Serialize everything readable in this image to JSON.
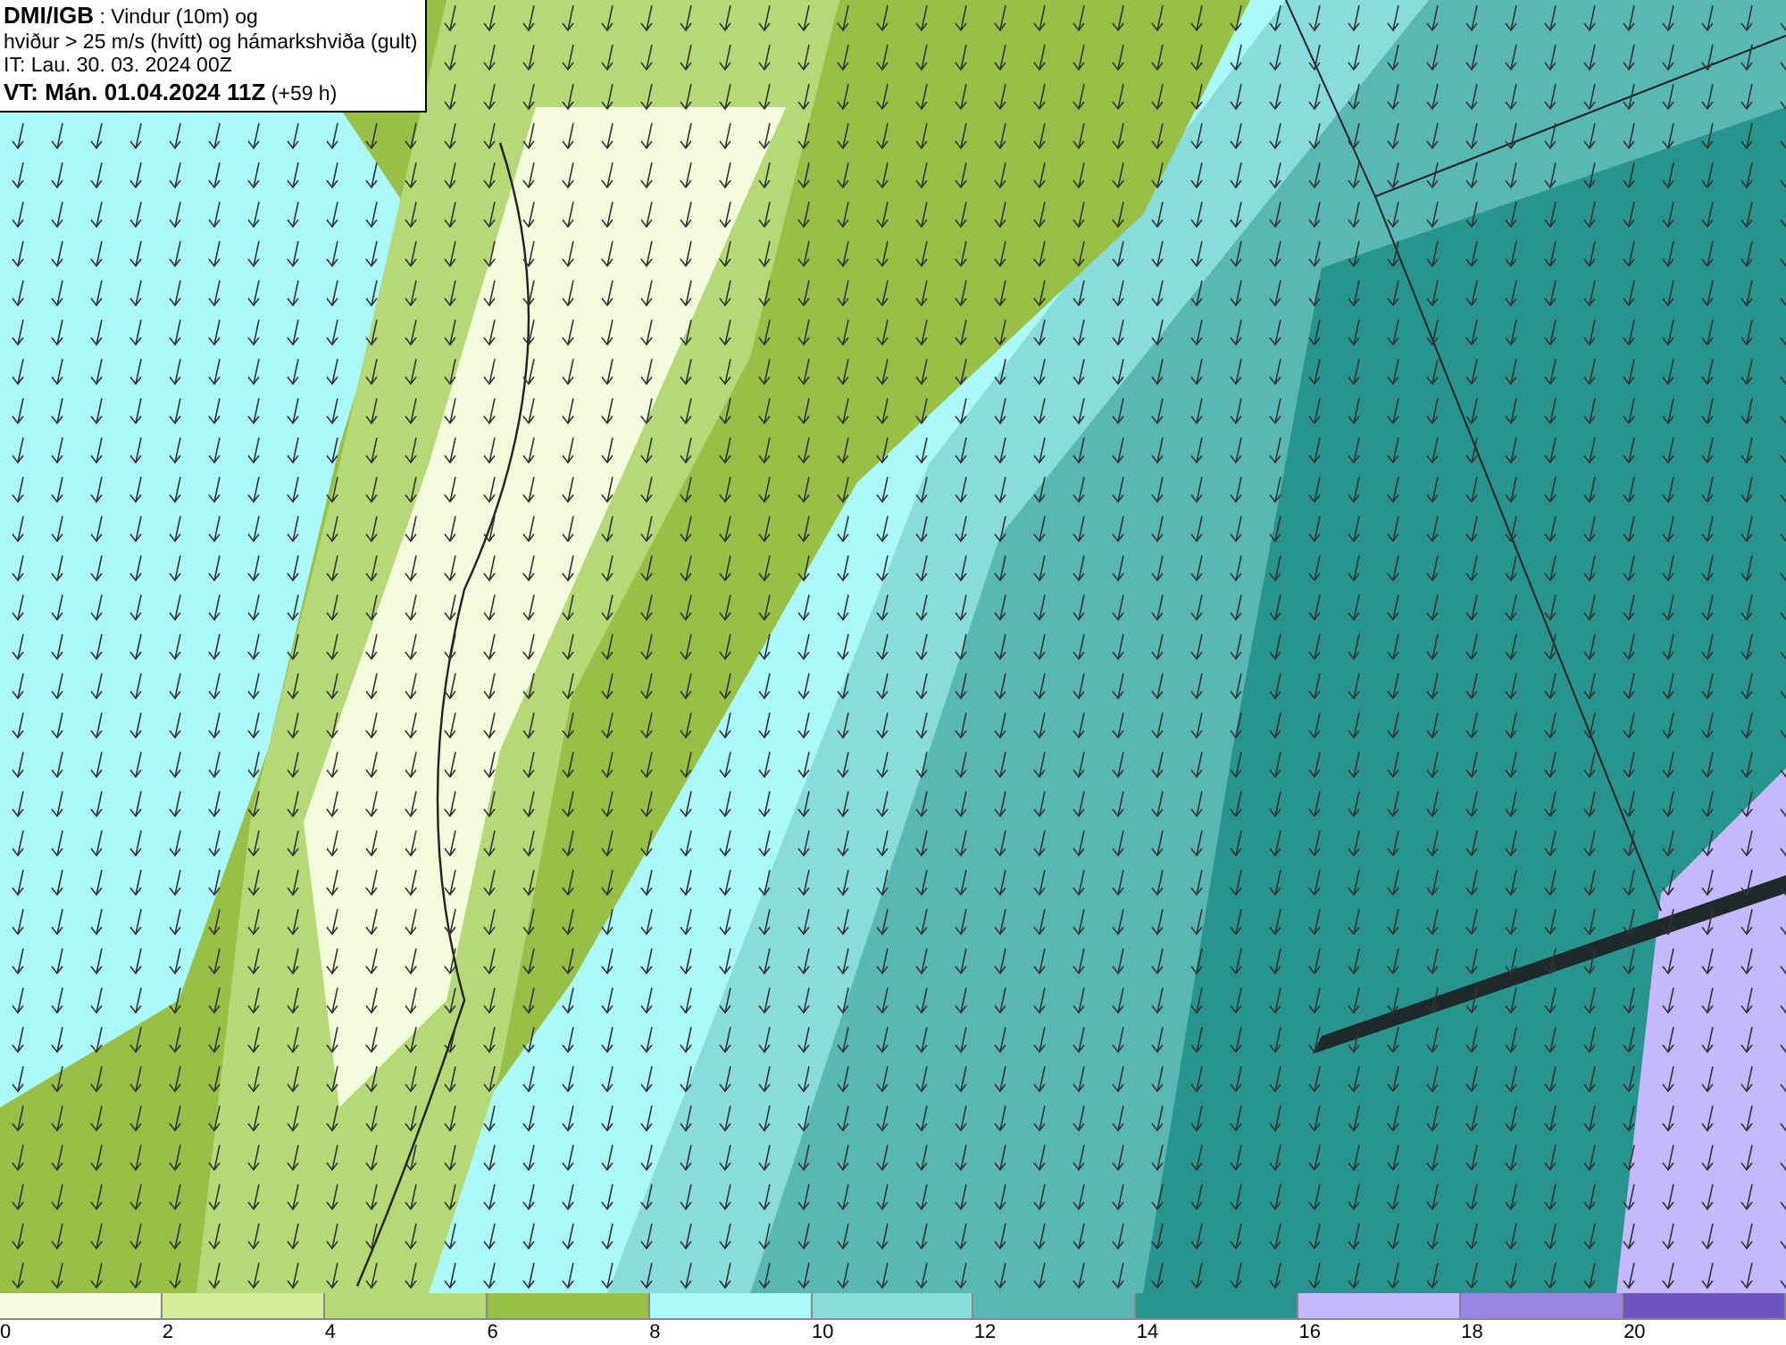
{
  "title_box": {
    "lines": [
      "**DMI/IGB** : Vindur (10m) og",
      "hviður > 25 m/s (hvítt) og hámarkshviða (gult)",
      "IT: Lau. 30. 03. 2024 00Z",
      "**VT: Mán. 01.04.2024 11Z** (+59 h)"
    ]
  },
  "legend": {
    "bins": [
      {
        "color": "#f4fbdd"
      },
      {
        "color": "#d6ed9a"
      },
      {
        "color": "#b6d978"
      },
      {
        "color": "#99c046"
      },
      {
        "color": "#aaf8f8"
      },
      {
        "color": "#88dcdc"
      },
      {
        "color": "#5ab8b4"
      },
      {
        "color": "#28948e"
      },
      {
        "color": "#c6b8fc"
      },
      {
        "color": "#9a86e2"
      },
      {
        "color": "#6e54c0"
      }
    ],
    "ticks": [
      "0",
      "2",
      "4",
      "6",
      "8",
      "10",
      "12",
      "14",
      "16",
      "18",
      "20"
    ]
  }
}
